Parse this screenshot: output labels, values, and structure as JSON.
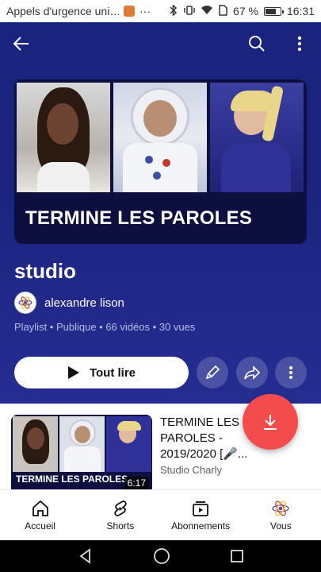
{
  "status_bar": {
    "notification": "Appels d'urgence uni…",
    "extra": "···",
    "battery": "67 %",
    "time": "16:31"
  },
  "playlist": {
    "thumbnail_title": "TERMINE LES PAROLES",
    "title": "studio",
    "owner": "alexandre lison",
    "meta": "Playlist • Publique • 66 vidéos • 30 vues"
  },
  "actions": {
    "play_all": "Tout lire"
  },
  "video": {
    "thumb_title": "TERMINE LES PAROLES",
    "duration": "6:17",
    "title": "TERMINE LES PAROLES - 2019/2020 [🎤...",
    "channel": "Studio Charly"
  },
  "nav": {
    "home": "Accueil",
    "shorts": "Shorts",
    "subscriptions": "Abonnements",
    "you": "Vous"
  },
  "colors": {
    "hero": "#1a237e",
    "fab": "#f44c4c"
  }
}
